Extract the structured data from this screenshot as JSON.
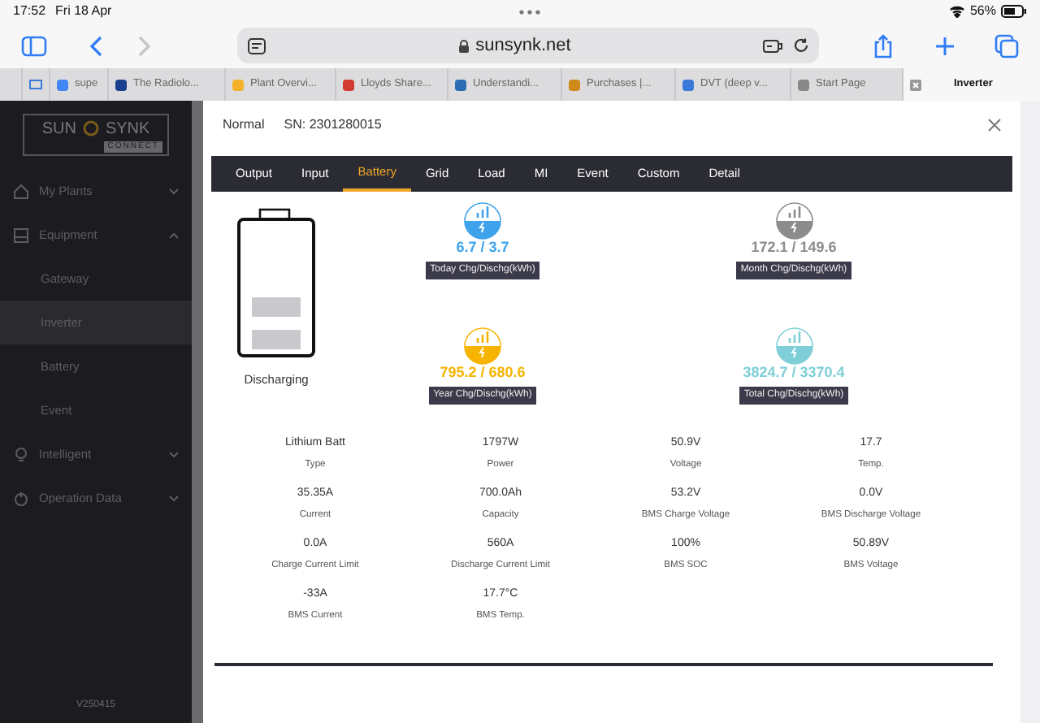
{
  "status_bar": {
    "time": "17:52",
    "date": "Fri 18 Apr",
    "battery": "56%"
  },
  "browser": {
    "url": "sunsynk.net",
    "tabs": [
      {
        "title": "supe",
        "selected": false
      },
      {
        "title": "The Radiolo...",
        "selected": false
      },
      {
        "title": "Plant Overvi...",
        "selected": false
      },
      {
        "title": "Lloyds Share...",
        "selected": false
      },
      {
        "title": "Understandi...",
        "selected": false
      },
      {
        "title": "Purchases |...",
        "selected": false
      },
      {
        "title": "DVT (deep v...",
        "selected": false
      },
      {
        "title": "Start Page",
        "selected": false
      },
      {
        "title": "Inverter",
        "selected": true
      }
    ]
  },
  "sidebar": {
    "logo": {
      "left": "SUN",
      "right": "SYNK",
      "sub": "CONNECT"
    },
    "items": [
      {
        "label": "My Plants",
        "expanded": false
      },
      {
        "label": "Equipment",
        "expanded": true,
        "children": [
          {
            "label": "Gateway",
            "selected": false
          },
          {
            "label": "Inverter",
            "selected": true
          },
          {
            "label": "Battery",
            "selected": false
          },
          {
            "label": "Event",
            "selected": false
          }
        ]
      },
      {
        "label": "Intelligent",
        "expanded": false
      },
      {
        "label": "Operation Data",
        "expanded": false
      }
    ],
    "version": "V250415"
  },
  "modal": {
    "status": "Normal",
    "serial": "SN: 2301280015",
    "tabs": [
      {
        "label": "Output",
        "selected": false
      },
      {
        "label": "Input",
        "selected": false
      },
      {
        "label": "Battery",
        "selected": true
      },
      {
        "label": "Grid",
        "selected": false
      },
      {
        "label": "Load",
        "selected": false
      },
      {
        "label": "MI",
        "selected": false
      },
      {
        "label": "Event",
        "selected": false
      },
      {
        "label": "Custom",
        "selected": false
      },
      {
        "label": "Detail",
        "selected": false
      }
    ],
    "battery_state": "Discharging",
    "stats": [
      {
        "value": "6.7 / 3.7",
        "label": "Today Chg/Dischg(kWh)",
        "color": "#3ea3ec"
      },
      {
        "value": "172.1 / 149.6",
        "label": "Month Chg/Dischg(kWh)",
        "color": "#8c8c8c"
      },
      {
        "value": "795.2 / 680.6",
        "label": "Year Chg/Dischg(kWh)",
        "color": "#f6b400"
      },
      {
        "value": "3824.7 / 3370.4",
        "label": "Total Chg/Dischg(kWh)",
        "color": "#7fcfd8"
      }
    ],
    "readings": [
      {
        "value": "Lithium Batt",
        "label": "Type"
      },
      {
        "value": "1797W",
        "label": "Power"
      },
      {
        "value": "50.9V",
        "label": "Voltage"
      },
      {
        "value": "17.7",
        "label": "Temp."
      },
      {
        "value": "35.35A",
        "label": "Current"
      },
      {
        "value": "700.0Ah",
        "label": "Capacity"
      },
      {
        "value": "53.2V",
        "label": "BMS Charge Voltage"
      },
      {
        "value": "0.0V",
        "label": "BMS Discharge Voltage"
      },
      {
        "value": "0.0A",
        "label": "Charge Current Limit"
      },
      {
        "value": "560A",
        "label": "Discharge Current Limit"
      },
      {
        "value": "100%",
        "label": "BMS SOC"
      },
      {
        "value": "50.89V",
        "label": "BMS Voltage"
      },
      {
        "value": "-33A",
        "label": "BMS Current"
      },
      {
        "value": "17.7°C",
        "label": "BMS Temp."
      }
    ]
  }
}
